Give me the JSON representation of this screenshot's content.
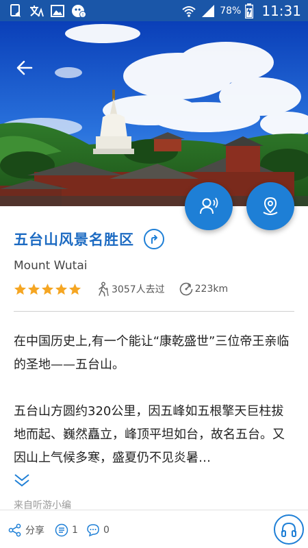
{
  "status_bar": {
    "battery_percent": "78%",
    "time": "11:31",
    "left_icons": [
      "notification-icon",
      "translate-icon",
      "image-icon",
      "ghost-notification-icon"
    ],
    "right_icons": [
      "wifi-icon",
      "signal-icon",
      "battery-charging-icon"
    ]
  },
  "hero": {
    "back_icon": "arrow-left-icon"
  },
  "fabs": {
    "audio_guide_icon": "audio-guide-icon",
    "location_icon": "location-pin-icon"
  },
  "scenic": {
    "title": "五台山风景名胜区",
    "subtitle": "Mount Wutai",
    "rating": 5,
    "rating_max": 5,
    "visitors": "3057人去过",
    "distance": "223km"
  },
  "description": {
    "paragraphs": [
      "在中国历史上,有一个能让“康乾盛世”三位帝王亲临的圣地——五台山。",
      "五台山方圆约320公里，因五峰如五根擎天巨柱拔地而起、巍然矗立，峰顶平坦如台，故名五台。又因山上气候多寒，盛夏仍不见炎暑…"
    ],
    "source": "来自听游小编"
  },
  "bottom_bar": {
    "share_label": "分享",
    "comment_count": "1",
    "like_count": "0"
  },
  "colors": {
    "status_bar": "#1a56a8",
    "accent": "#1e7fd6",
    "title": "#1d6bc2",
    "star": "#f5a623"
  }
}
